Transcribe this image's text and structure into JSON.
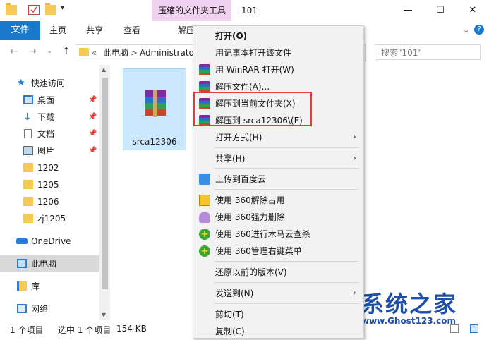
{
  "titlebar": {
    "context_tab": "压缩的文件夹工具",
    "window_title": "101",
    "minimize": "—",
    "maximize": "☐",
    "close": "✕"
  },
  "ribbon": {
    "file": "文件",
    "home": "主页",
    "share": "共享",
    "view": "查看",
    "extract": "解压",
    "expand": "⌄",
    "help": "?"
  },
  "address": {
    "back": "←",
    "forward": "→",
    "recent": "⌄",
    "up": "↑",
    "overflow": "«",
    "crumb1": "此电脑",
    "crumb2": "Administrato",
    "sep": ">",
    "search_placeholder": "搜索\"101\""
  },
  "nav": {
    "quick_access": "快速访问",
    "desktop": "桌面",
    "downloads": "下载",
    "documents": "文档",
    "pictures": "图片",
    "f1202": "1202",
    "f1205": "1205",
    "f1206": "1206",
    "zj1205": "zj1205",
    "onedrive": "OneDrive",
    "this_pc": "此电脑",
    "libraries": "库",
    "network": "网络",
    "pin": "📌",
    "expand": "›"
  },
  "file": {
    "name": "srca12306"
  },
  "status": {
    "count": "1 个项目",
    "selected": "选中 1 个项目",
    "size": "154 KB"
  },
  "menu": {
    "open": "打开(O)",
    "notepad": "用记事本打开该文件",
    "winrar_open": "用 WinRAR 打开(W)",
    "extract_files": "解压文件(A)...",
    "extract_here": "解压到当前文件夹(X)",
    "extract_to": "解压到 srca12306\\(E)",
    "open_with": "打开方式(H)",
    "share": "共享(H)",
    "upload_baidu": "上传到百度云",
    "unlock_360": "使用 360解除占用",
    "force_delete_360": "使用 360强力删除",
    "trojan_scan_360": "使用 360进行木马云查杀",
    "menu_manage_360": "使用 360管理右键菜单",
    "restore": "还原以前的版本(V)",
    "send_to": "发送到(N)",
    "cut": "剪切(T)",
    "copy": "复制(C)",
    "arrow": "›"
  },
  "watermark": {
    "title": "系统之家",
    "url": "www.Ghost123.com"
  },
  "colors": {
    "accent": "#1979ca",
    "ctx_tab": "#f2d2f1",
    "selection": "#cce8ff",
    "highlight": "#e23a3a"
  }
}
